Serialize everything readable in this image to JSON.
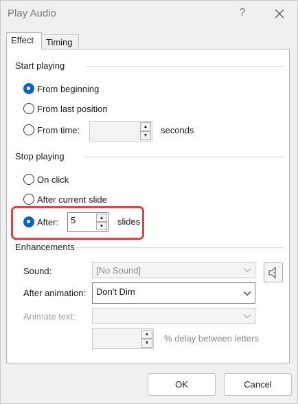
{
  "window": {
    "title": "Play Audio",
    "help": "?"
  },
  "tabs": [
    {
      "label": "Effect",
      "active": true
    },
    {
      "label": "Timing",
      "active": false
    }
  ],
  "start_playing": {
    "heading": "Start playing",
    "options": [
      {
        "label": "From beginning",
        "checked": true
      },
      {
        "label": "From last position",
        "checked": false
      },
      {
        "label": "From time:",
        "checked": false
      }
    ],
    "time_value": "",
    "time_unit": "seconds"
  },
  "stop_playing": {
    "heading": "Stop playing",
    "options": [
      {
        "label": "On click",
        "checked": false
      },
      {
        "label": "After current slide",
        "checked": false
      },
      {
        "label": "After:",
        "checked": true
      }
    ],
    "after_value": "5",
    "after_unit": "slides",
    "highlight_color": "#e0414b"
  },
  "enhancements": {
    "heading": "Enhancements",
    "sound_label": "Sound:",
    "sound_value": "[No Sound]",
    "after_animation_label": "After animation:",
    "after_animation_value": "Don't Dim",
    "animate_text_label": "Animate text:",
    "animate_text_value": "",
    "delay_value": "",
    "delay_label": "% delay between letters"
  },
  "buttons": {
    "ok": "OK",
    "cancel": "Cancel"
  },
  "colors": {
    "accent": "#0a64c8",
    "background": "#f0f0f0"
  }
}
